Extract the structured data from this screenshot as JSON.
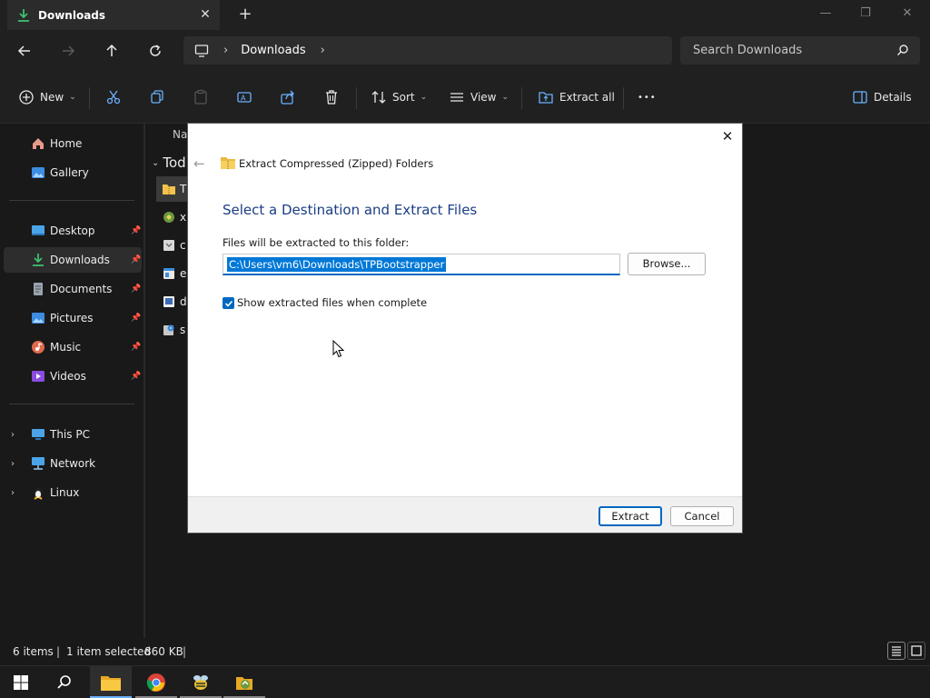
{
  "tab": {
    "title": "Downloads",
    "close": "✕"
  },
  "titlebar": {
    "new_tab": "+",
    "minimize": "—",
    "restore": "❐",
    "close": "✕"
  },
  "address": {
    "separator": "›",
    "crumb": "Downloads",
    "separator2": "›"
  },
  "search": {
    "placeholder": "Search Downloads"
  },
  "toolbar": {
    "new_label": "New",
    "sort_label": "Sort",
    "view_label": "View",
    "extract_all_label": "Extract all",
    "more_label": "•••",
    "details_label": "Details",
    "chevron": "⌄"
  },
  "sidebar": {
    "quick": [
      {
        "label": "Home"
      },
      {
        "label": "Gallery"
      }
    ],
    "pinned": [
      {
        "label": "Desktop",
        "pin": "📌"
      },
      {
        "label": "Downloads",
        "pin": "📌"
      },
      {
        "label": "Documents",
        "pin": "📌"
      },
      {
        "label": "Pictures",
        "pin": "📌"
      },
      {
        "label": "Music",
        "pin": "📌"
      },
      {
        "label": "Videos",
        "pin": "📌"
      }
    ],
    "tree": [
      {
        "label": "This PC",
        "expander": "›"
      },
      {
        "label": "Network",
        "expander": "›"
      },
      {
        "label": "Linux",
        "expander": "›"
      }
    ]
  },
  "filelist": {
    "column_name": "Na",
    "group": "Tod",
    "group_chevron": "⌄",
    "rows": [
      {
        "name": "T"
      },
      {
        "name": "x"
      },
      {
        "name": "c"
      },
      {
        "name": "e"
      },
      {
        "name": "d"
      },
      {
        "name": "s"
      }
    ]
  },
  "status": {
    "items": "6 items",
    "sep1": "|",
    "selected": "1 item selected",
    "size": "860 KB",
    "sep2": "|"
  },
  "dialog": {
    "close": "✕",
    "back": "←",
    "title": "Extract Compressed (Zipped) Folders",
    "heading": "Select a Destination and Extract Files",
    "path_label": "Files will be extracted to this folder:",
    "path_value": "C:\\Users\\vm6\\Downloads\\TPBootstrapper",
    "browse": "Browse...",
    "checkbox_label": "Show extracted files when complete",
    "checkbox_checked": true,
    "extract": "Extract",
    "cancel": "Cancel"
  },
  "colors": {
    "accent": "#0067c0",
    "heading": "#1a3e84",
    "download_green": "#3fbf6f"
  }
}
